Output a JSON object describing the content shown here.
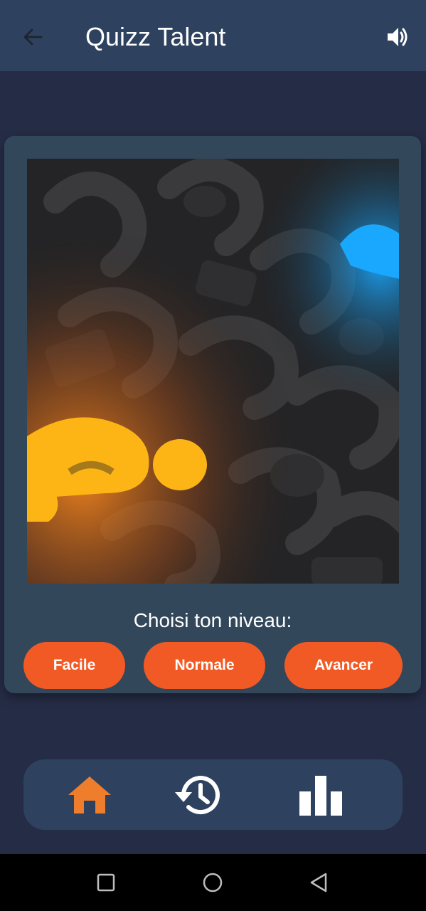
{
  "header": {
    "title": "Quizz Talent",
    "back_icon": "arrow-left-icon",
    "sound_icon": "volume-up-icon"
  },
  "card": {
    "image": "question-marks-illustration",
    "prompt": "Choisi ton niveau:",
    "levels": [
      {
        "label": "Facile"
      },
      {
        "label": "Normale"
      },
      {
        "label": "Avancer"
      }
    ]
  },
  "bottom_nav": {
    "items": [
      {
        "icon": "home-icon",
        "active": true
      },
      {
        "icon": "history-icon",
        "active": false
      },
      {
        "icon": "bar-chart-icon",
        "active": false
      }
    ]
  },
  "system_nav": {
    "items": [
      "recents-icon",
      "home-circle-icon",
      "back-triangle-icon"
    ]
  },
  "colors": {
    "background": "#252c45",
    "app_bar": "#2e4260",
    "card": "#33475a",
    "accent_button": "#f25a25",
    "active_nav_icon": "#ee7d2c",
    "icon_white": "#ffffff"
  }
}
